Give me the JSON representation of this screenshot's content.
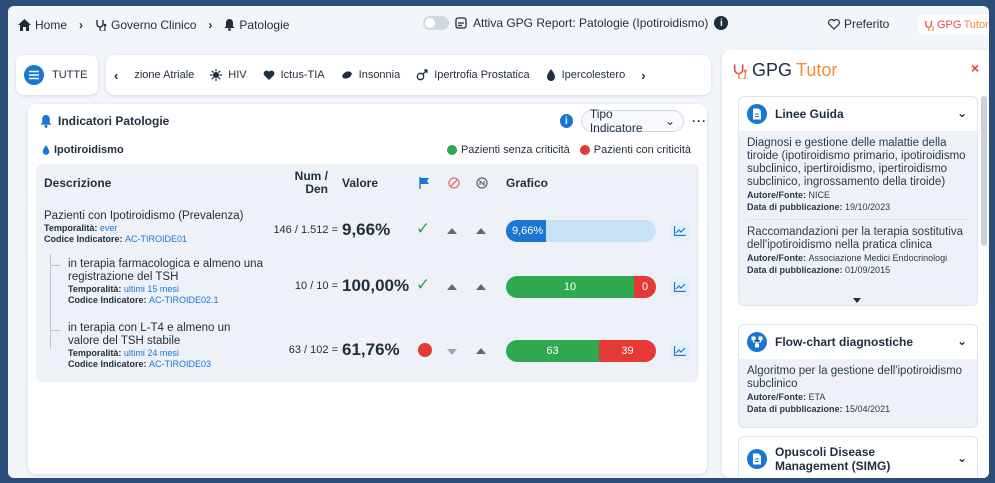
{
  "breadcrumb": {
    "home": "Home",
    "governo": "Governo Clinico",
    "patologie": "Patologie"
  },
  "toggle": {
    "label": "Attiva GPG Report: Patologie (Ipotiroidismo)"
  },
  "header": {
    "preferito": "Preferito",
    "brand_gpg": "GPG",
    "brand_tutor": "Tutor"
  },
  "categories": {
    "tutte": "TUTTE",
    "items": [
      "zione Atriale",
      "HIV",
      "Ictus-TIA",
      "Insonnia",
      "Ipertrofia Prostatica",
      "Ipercolestero"
    ]
  },
  "panel": {
    "title": "Indicatori Patologie",
    "tipo": "Tipo Indicatore",
    "more": "···",
    "sub": "Ipotiroidismo",
    "legend_ok": "Pazienti senza criticità",
    "legend_ko": "Pazienti con criticità"
  },
  "colors": {
    "ok": "#2fa84f",
    "ko": "#e53935",
    "accent": "#1976d2",
    "light_bar": "#c6e2f7"
  },
  "table": {
    "headers": {
      "descr": "Descrizione",
      "numden": "Num / Den",
      "valore": "Valore",
      "grafico": "Grafico"
    },
    "rows": [
      {
        "title": "Pazienti con Ipotiroidismo (Prevalenza)",
        "temp_label": "Temporalità:",
        "temp": "ever",
        "code_label": "Codice Indicatore:",
        "code": "AC-TIROIDE01",
        "numden": "146 / 1.512",
        "eq": "=",
        "valore": "9,66%",
        "bar_label": "9,66%",
        "bar_pct": 9.66
      },
      {
        "title": "in terapia farmacologica e almeno una registrazione del TSH",
        "temp_label": "Temporalità:",
        "temp": "ultimi 15 mesi",
        "code_label": "Codice Indicatore:",
        "code": "AC-TIROIDE02.1",
        "numden": "10 / 10",
        "eq": "=",
        "valore": "100,00%",
        "ok": "10",
        "ko": "0"
      },
      {
        "title": "in terapia con L-T4 e almeno un valore del TSH stabile",
        "temp_label": "Temporalità:",
        "temp": "ultimi 24 mesi",
        "code_label": "Codice Indicatore:",
        "code": "AC-TIROIDE03",
        "numden": "63 / 102",
        "eq": "=",
        "valore": "61,76%",
        "ok": "63",
        "ko": "39"
      }
    ]
  },
  "tutor": {
    "title_gpg": "GPG",
    "title_tutor": "Tutor",
    "close": "×",
    "linee": {
      "title": "Linee Guida",
      "items": [
        {
          "text": "Diagnosi e gestione delle malattie della tiroide (ipotiroidismo primario, ipotiroidismo subclinico, ipertiroidismo, ipertiroidismo subclinico, ingrossamento della tiroide)",
          "autore_label": "Autore/Fonte:",
          "autore": "NICE",
          "data_label": "Data di pubblicazione:",
          "data": "19/10/2023"
        },
        {
          "text": "Raccomandazioni per la terapia sostitutiva dell'ipotiroidismo nella pratica clinica",
          "autore_label": "Autore/Fonte:",
          "autore": "Associazione Medici Endocrinologi",
          "data_label": "Data di pubblicazione:",
          "data": "01/09/2015"
        }
      ]
    },
    "flow": {
      "title": "Flow-chart diagnostiche",
      "text": "Algoritmo per la gestione dell'ipotiroidismo subclinico",
      "autore_label": "Autore/Fonte:",
      "autore": "ETA",
      "data_label": "Data di pubblicazione:",
      "data": "15/04/2021"
    },
    "opuscoli": {
      "title": "Opuscoli Disease Management (SIMG)"
    }
  }
}
